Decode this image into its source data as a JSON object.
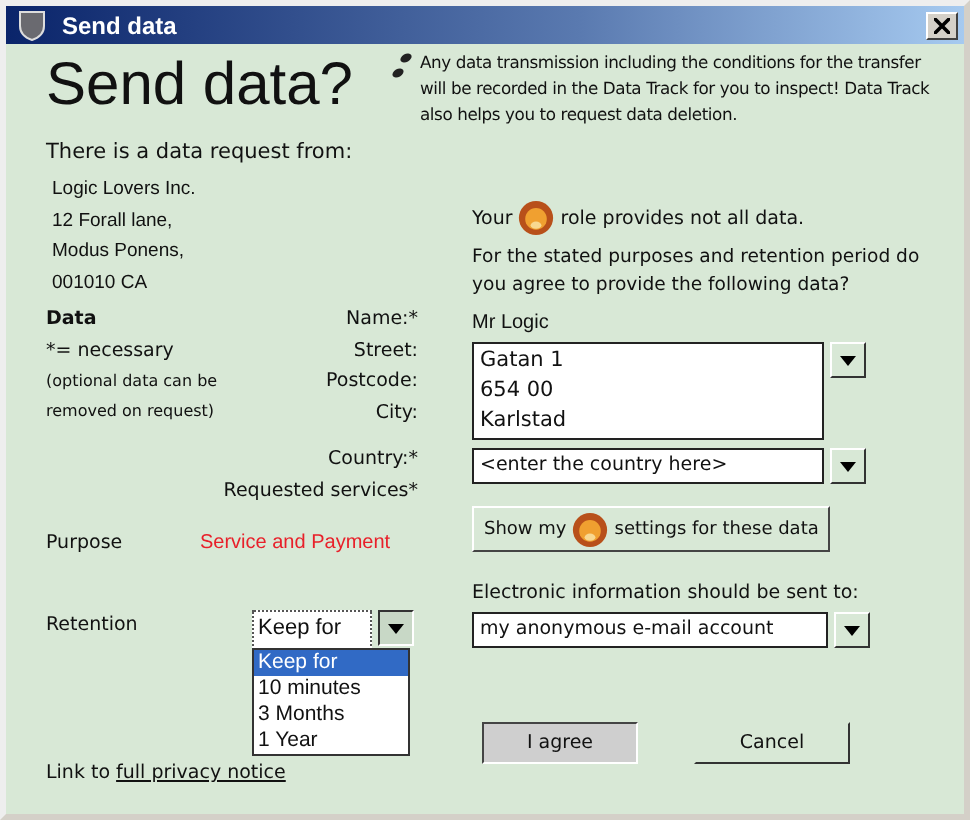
{
  "window": {
    "title": "Send data"
  },
  "heading": "Send data?",
  "notice": "Any data transmission including the conditions for the transfer will be recorded in the Data Track for you to inspect! Data Track also helps you to request data deletion.",
  "request": {
    "intro": "There is a data request from:",
    "address": [
      "Logic Lovers Inc.",
      "12 Forall lane,",
      "Modus Ponens,",
      "001010 CA"
    ]
  },
  "data_section": {
    "title": "Data",
    "legend": "*= necessary",
    "note": "(optional data can be removed on request)"
  },
  "role_message": {
    "before": "Your",
    "after": "role provides not all data."
  },
  "question": "For the stated purposes and retention period do you agree to provide the following data?",
  "name": {
    "label": "Name:*",
    "value": "Mr Logic"
  },
  "address": {
    "labels": [
      "Street:",
      "Postcode:",
      "City:"
    ],
    "lines": [
      "Gatan 1",
      "654 00",
      "Karlstad"
    ]
  },
  "country": {
    "label": "Country:*",
    "value": "<enter the country here>"
  },
  "services": {
    "label": "Requested services*"
  },
  "settings_button": {
    "before": "Show my",
    "after": "settings for these data"
  },
  "purpose": {
    "label": "Purpose",
    "value": "Service and Payment"
  },
  "retention": {
    "label": "Retention",
    "value": "Keep for",
    "expanded": true,
    "options": [
      {
        "label": "Keep for",
        "selected": true
      },
      {
        "label": "10 minutes",
        "selected": false
      },
      {
        "label": "3 Months",
        "selected": false
      },
      {
        "label": "1 Year",
        "selected": false
      }
    ]
  },
  "delivery": {
    "label": "Electronic information should be sent to:",
    "value": "my anonymous e-mail account"
  },
  "privacy": {
    "text": "Link to",
    "link": "full privacy notice"
  },
  "buttons": [
    {
      "label": "I agree",
      "pressed": true
    },
    {
      "label": "Cancel",
      "pressed": false
    }
  ]
}
